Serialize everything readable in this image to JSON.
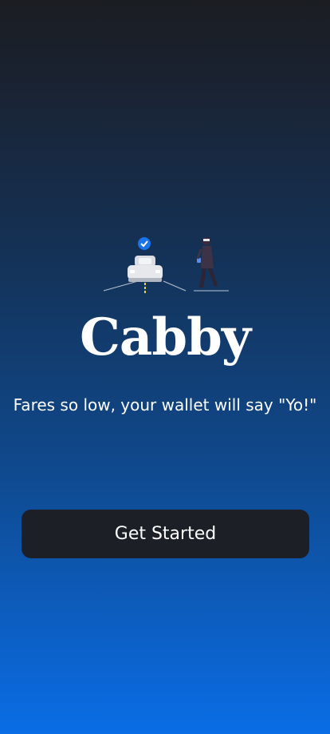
{
  "app": {
    "name": "Cabby",
    "tagline": "Fares so low, your wallet will say \"Yo!\""
  },
  "actions": {
    "get_started_label": "Get Started"
  },
  "hero": {
    "illustration": "taxi-and-passenger-illustration",
    "badge_icon": "check-badge-icon"
  },
  "colors": {
    "gradient_top": "#1b1d22",
    "gradient_bottom": "#0a6de6",
    "button_bg": "#1c1f26",
    "badge_blue": "#1a73e8"
  }
}
